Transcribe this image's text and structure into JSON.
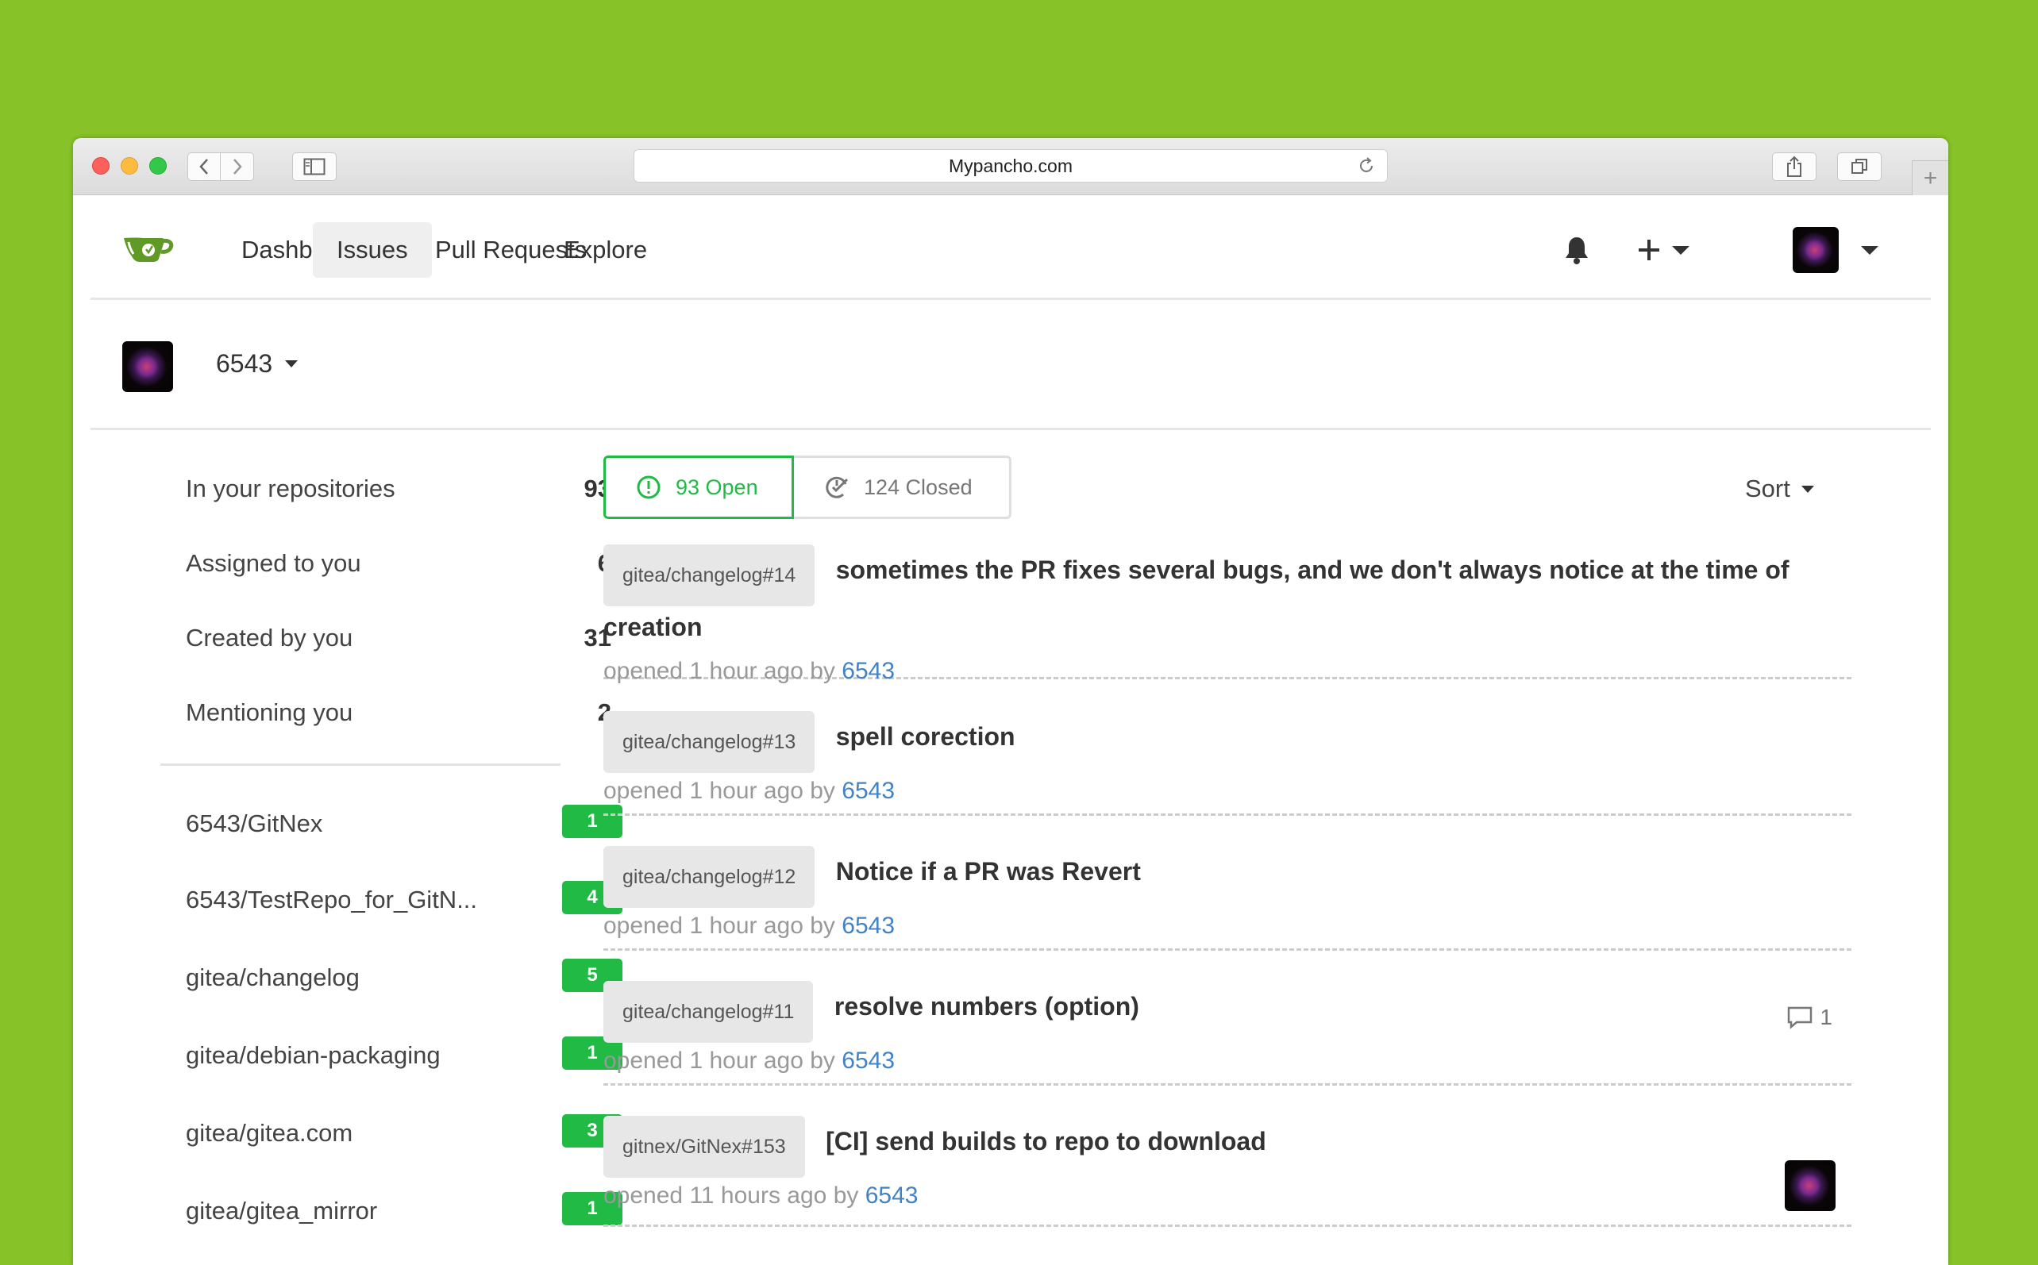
{
  "browser": {
    "url": "Mypancho.com"
  },
  "nav": {
    "items": [
      "Dashboard",
      "Issues",
      "Pull Requests",
      "Explore"
    ],
    "active": "Issues"
  },
  "context": {
    "user": "6543"
  },
  "sidebar": {
    "filters": [
      {
        "label": "In your repositories",
        "count": "93"
      },
      {
        "label": "Assigned to you",
        "count": "6"
      },
      {
        "label": "Created by you",
        "count": "31"
      },
      {
        "label": "Mentioning you",
        "count": "2"
      }
    ],
    "repos": [
      {
        "name": "6543/GitNex",
        "count": "1"
      },
      {
        "name": "6543/TestRepo_for_GitN...",
        "count": "4"
      },
      {
        "name": "gitea/changelog",
        "count": "5"
      },
      {
        "name": "gitea/debian-packaging",
        "count": "1"
      },
      {
        "name": "gitea/gitea.com",
        "count": "3"
      },
      {
        "name": "gitea/gitea_mirror",
        "count": "1"
      }
    ]
  },
  "list": {
    "open_label": "93 Open",
    "closed_label": "124 Closed",
    "sort_label": "Sort",
    "issues": [
      {
        "ref": "gitea/changelog#14",
        "title": "sometimes the PR fixes several bugs, and we don't always notice at the time of creation",
        "meta": "opened 1 hour ago by",
        "author": "6543"
      },
      {
        "ref": "gitea/changelog#13",
        "title": "spell corection",
        "meta": "opened 1 hour ago by",
        "author": "6543"
      },
      {
        "ref": "gitea/changelog#12",
        "title": "Notice if a PR was Revert",
        "meta": "opened 1 hour ago by",
        "author": "6543"
      },
      {
        "ref": "gitea/changelog#11",
        "title": "resolve numbers (option)",
        "meta": "opened 1 hour ago by",
        "author": "6543",
        "comments": "1"
      },
      {
        "ref": "gitnex/GitNex#153",
        "title": "[CI] send builds to repo to download",
        "meta": "opened 11 hours ago by",
        "author": "6543"
      }
    ]
  },
  "colors": {
    "background": "#86c228",
    "accent_green": "#21ba45",
    "link_blue": "#4183c4",
    "gitea_logo": "#609926"
  },
  "icons": [
    "back-icon",
    "forward-icon",
    "sidebar-icon",
    "reload-icon",
    "share-icon",
    "tabs-icon",
    "plus-icon",
    "gitea-logo",
    "bell-icon",
    "caret-down-icon",
    "issue-open-icon",
    "issue-closed-icon",
    "comment-icon"
  ]
}
